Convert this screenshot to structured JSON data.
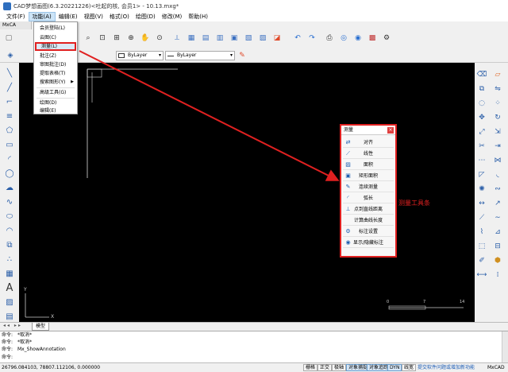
{
  "window": {
    "title": "CAD梦想画图(6.3.20221226)<吐起的核, 会员1> - 10.13.mxg*"
  },
  "menubar": [
    {
      "label": "文件(F)"
    },
    {
      "label": "功能(A)"
    },
    {
      "label": "编辑(E)"
    },
    {
      "label": "视图(V)"
    },
    {
      "label": "格式(O)"
    },
    {
      "label": "绘图(D)"
    },
    {
      "label": "修改(M)"
    },
    {
      "label": "帮助(H)"
    }
  ],
  "tabstrip": {
    "label": "MxCA"
  },
  "dropdown": {
    "items": [
      {
        "label": "会员登陆(L)"
      },
      {
        "label": "云图(C)"
      },
      {
        "label": "测量(L)"
      },
      {
        "label": "批注(Z)"
      },
      {
        "label": "审图批注(D)"
      },
      {
        "label": "提取表格(T)"
      },
      {
        "label": "搜索图形(Y)"
      },
      {
        "label": "高级工具(G)"
      },
      {
        "label": "绘图(D)"
      },
      {
        "label": "编辑(E)"
      }
    ]
  },
  "layer_bar": {
    "color_combo": "ByLayer",
    "linetype_combo": "ByLayer"
  },
  "measure_panel": {
    "title": "测量",
    "close": "×",
    "items": [
      {
        "label": "对齐",
        "icon": "align-icon"
      },
      {
        "label": "线性",
        "icon": "linear-icon"
      },
      {
        "label": "面积",
        "icon": "area-icon"
      },
      {
        "label": "矩形面积",
        "icon": "rect-area-icon"
      },
      {
        "label": "连续测量",
        "icon": "continuous-icon"
      },
      {
        "label": "弧长",
        "icon": "arc-length-icon"
      },
      {
        "label": "点到直线距离",
        "icon": "point-line-icon"
      },
      {
        "label": "计算曲线长度",
        "icon": "curve-length-icon"
      },
      {
        "label": "标注设置",
        "icon": "dim-settings-icon"
      },
      {
        "label": "显示/隐藏标注",
        "icon": "eye-icon"
      }
    ]
  },
  "callout": {
    "text": "测量工具条"
  },
  "canvas": {
    "axis_y": "Y",
    "axis_x": "X",
    "scale_labels": [
      "0",
      "7",
      "14"
    ]
  },
  "layout_tabs": {
    "arrows": "◂◂ ▸▸",
    "model": "模型"
  },
  "command": {
    "lines": [
      {
        "prefix": "命令:",
        "text": "*取消*"
      },
      {
        "prefix": "命令:",
        "text": "*取消*"
      },
      {
        "prefix": "命令:",
        "text": "Mx_ShowAnnotation"
      },
      {
        "prefix": "命令:",
        "text": ""
      }
    ]
  },
  "statusbar": {
    "coords": "26796.084103, 78807.112106, 0.000000",
    "buttons": [
      "栅格",
      "正交",
      "极轴",
      "对象捕捉",
      "对象追踪",
      "DYN",
      "线宽"
    ],
    "active": [
      "对象捕捉",
      "对象追踪",
      "DYN"
    ],
    "hint": "提交软件问题或增加新功能",
    "brand": "MxCAD"
  },
  "colors": {
    "accent": "#e02020",
    "canvas": "#000000",
    "tool_blue": "#2a5ea8"
  }
}
